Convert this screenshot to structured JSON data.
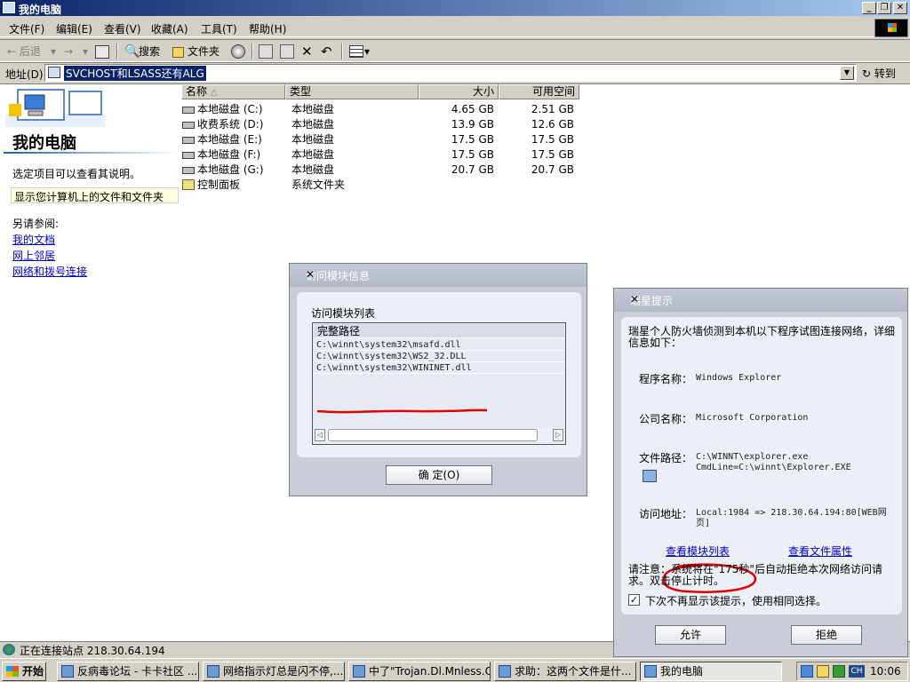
{
  "window": {
    "title": "我的电脑",
    "min_glyph": "_",
    "max_glyph": "❐",
    "close_glyph": "✕"
  },
  "menu": [
    "文件(F)",
    "编辑(E)",
    "查看(V)",
    "收藏(A)",
    "工具(T)",
    "帮助(H)"
  ],
  "toolbar": {
    "back": "← 后退",
    "back_drop": "▾",
    "forward": "→",
    "forward_drop": "▾",
    "search": "搜索",
    "folders": "文件夹",
    "views_drop": "▾"
  },
  "address": {
    "label": "地址(D)",
    "value": "SVCHOST和LSASS还有ALG",
    "dropdown_glyph": "▼",
    "go": "转到"
  },
  "left_panel": {
    "title": "我的电脑",
    "hint": "选定项目可以查看其说明。",
    "info": "显示您计算机上的文件和文件夹",
    "see_also": "另请参阅:",
    "links": [
      "我的文档",
      "网上邻居",
      "网络和拨号连接"
    ]
  },
  "list": {
    "columns": [
      "名称",
      "类型",
      "大小",
      "可用空间"
    ],
    "sort_glyph": "△",
    "rows": [
      {
        "name": "本地磁盘 (C:)",
        "type": "本地磁盘",
        "size": "4.65 GB",
        "free": "2.51 GB"
      },
      {
        "name": "收费系统 (D:)",
        "type": "本地磁盘",
        "size": "13.9 GB",
        "free": "12.6 GB"
      },
      {
        "name": "本地磁盘 (E:)",
        "type": "本地磁盘",
        "size": "17.5 GB",
        "free": "17.5 GB"
      },
      {
        "name": "本地磁盘 (F:)",
        "type": "本地磁盘",
        "size": "17.5 GB",
        "free": "17.5 GB"
      },
      {
        "name": "本地磁盘 (G:)",
        "type": "本地磁盘",
        "size": "20.7 GB",
        "free": "20.7 GB"
      },
      {
        "name": "控制面板",
        "type": "系统文件夹",
        "size": "",
        "free": ""
      }
    ]
  },
  "status": {
    "text": "正在连接站点 218.30.64.194"
  },
  "dialog_modules": {
    "title": "访问模块信息",
    "close": "✕",
    "list_label": "访问模块列表",
    "column": "完整路径",
    "paths": [
      "C:\\winnt\\system32\\msafd.dll",
      "C:\\winnt\\system32\\WS2_32.DLL",
      "C:\\winnt\\system32\\WININET.dll"
    ],
    "scroll_left": "◁",
    "scroll_right": "▷",
    "ok": "确 定(O)"
  },
  "dialog_rising": {
    "title": "瑞星提示",
    "close": "✕",
    "intro": "瑞星个人防火墙侦测到本机以下程序试图连接网络，详细信息如下：",
    "program_label": "程序名称：",
    "program_value": "Windows Explorer",
    "company_label": "公司名称：",
    "company_value": "Microsoft Corporation",
    "path_label": "文件路径：",
    "path_value_1": "C:\\WINNT\\explorer.exe",
    "path_value_2": "CmdLine=C:\\winnt\\Explorer.EXE",
    "address_label": "访问地址：",
    "address_value": "Local:1984 => 218.30.64.194:80[WEB网页]",
    "link_modules": "查看模块列表",
    "link_props": "查看文件属性",
    "note": "请注意：系统将在\"175秒\"后自动拒绝本次网络访问请求。双击停止计时。",
    "checkbox_mark": "✓",
    "checkbox_label": "下次不再显示该提示，使用相同选择。",
    "allow": "允许",
    "deny": "拒绝"
  },
  "taskbar": {
    "start": "开始",
    "tasks": [
      "反病毒论坛 - 卡卡社区 ...",
      "网络指示灯总是闪不停,...",
      "中了\"Trojan.Dl.Mnless.O...",
      "求助：这两个文件是什...",
      "我的电脑"
    ],
    "tray_lang": "CH",
    "clock": "10:06"
  },
  "colors": {
    "title_blue": "#0a246a",
    "link_blue": "#0000cc",
    "annotation_red": "#e00000",
    "selection": "#0a246a"
  }
}
